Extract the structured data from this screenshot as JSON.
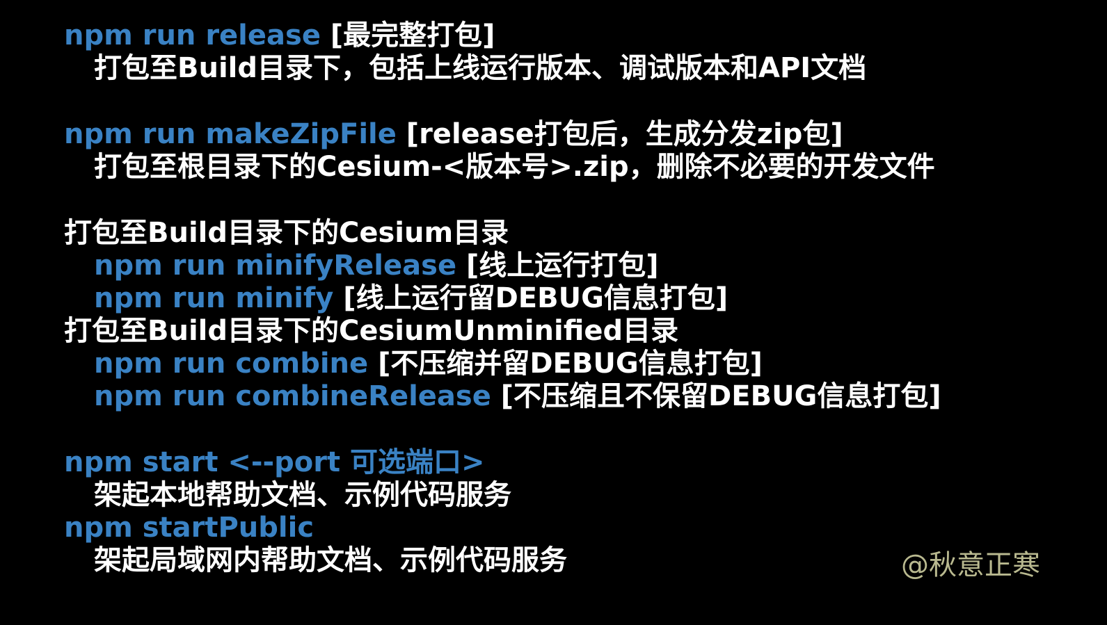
{
  "blocks": {
    "release": {
      "command": "npm run release",
      "tag": " [最完整打包]",
      "description": "打包至Build目录下，包括上线运行版本、调试版本和API文档"
    },
    "make_zip": {
      "command": "npm run makeZipFile",
      "tag": " [release打包后，生成分发zip包]",
      "description": "打包至根目录下的Cesium-<版本号>.zip，删除不必要的开发文件"
    },
    "cesium_dir": {
      "heading": "打包至Build目录下的Cesium目录",
      "items": [
        {
          "command": "npm run minifyRelease",
          "tag": " [线上运行打包]"
        },
        {
          "command": "npm run minify",
          "tag": " [线上运行留DEBUG信息打包]"
        }
      ]
    },
    "unminified_dir": {
      "heading": "打包至Build目录下的CesiumUnminified目录",
      "items": [
        {
          "command": "npm run combine",
          "tag": " [不压缩并留DEBUG信息打包]"
        },
        {
          "command": "npm run combineRelease",
          "tag": " [不压缩且不保留DEBUG信息打包]"
        }
      ]
    },
    "start": {
      "command": "npm start <--port 可选端口>",
      "description": "架起本地帮助文档、示例代码服务"
    },
    "start_public": {
      "command": "npm startPublic",
      "description": "架起局域网内帮助文档、示例代码服务"
    }
  },
  "watermark": "@秋意正寒",
  "colors": {
    "background": "#000000",
    "command": "#3a82c4",
    "text": "#ffffff",
    "watermark": "#b9b98f"
  }
}
